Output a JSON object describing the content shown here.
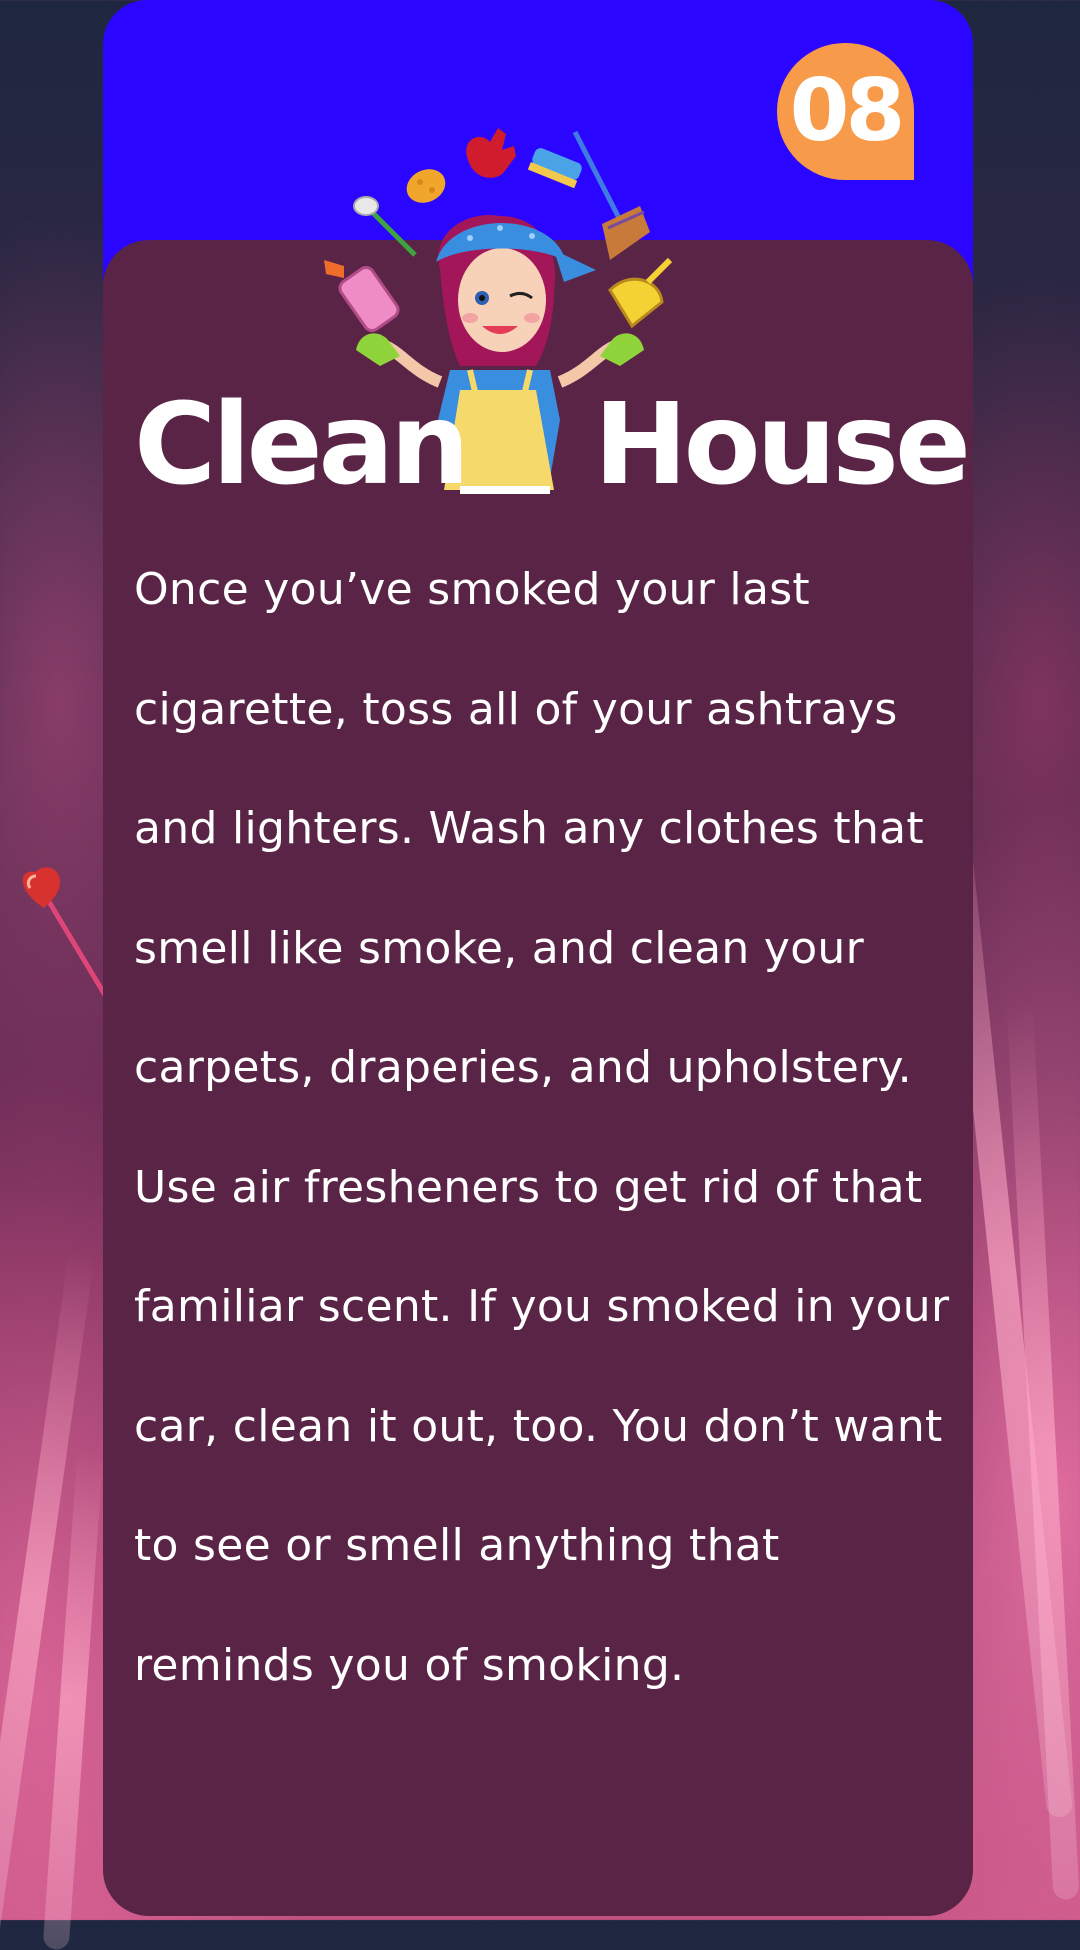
{
  "slide": {
    "number": "08",
    "title_left": "Clean",
    "title_right": "House",
    "body": "Once you’ve smoked your last cigarette, toss all of your ashtrays and lighters. Wash any clothes that smell like smoke, and clean your carpets, draperies, and upholstery. Use air fresheners to get rid of that familiar scent. If you smoked in your car, clean it out, too. You don’t want to see or smell anything that reminds you of smoking."
  },
  "colors": {
    "header": "#2a05ff",
    "card": "#5a2446",
    "badge": "#f79a49",
    "text": "#ffffff"
  },
  "icons": [
    "cleaning-lady-illustration",
    "heart-lollipop-icon"
  ]
}
